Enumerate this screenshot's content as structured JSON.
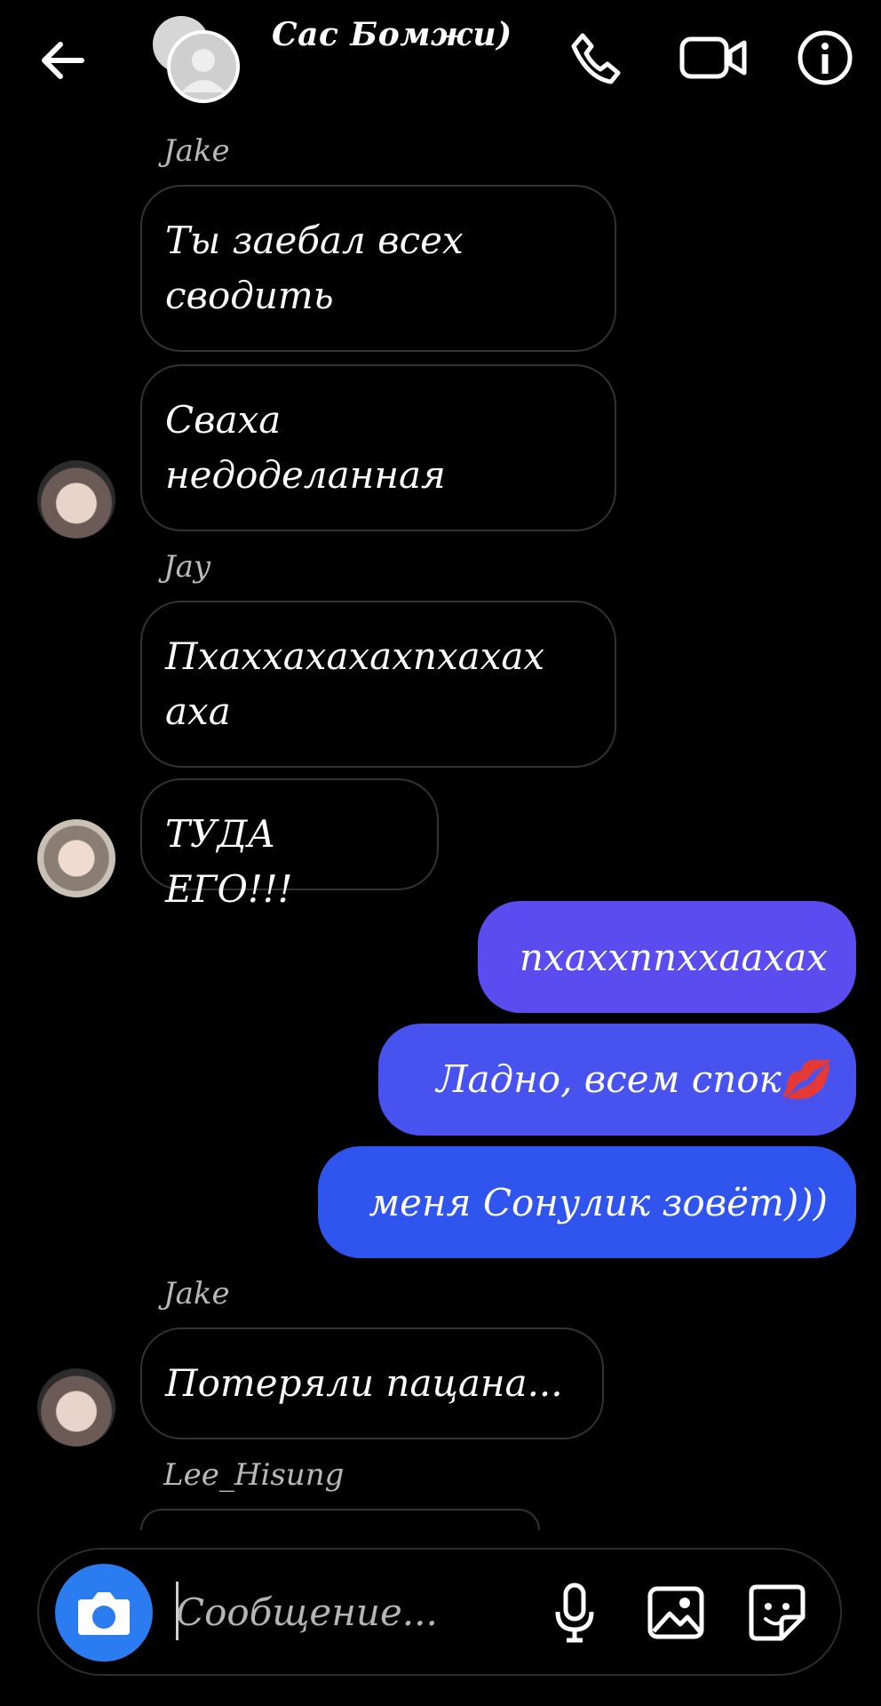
{
  "header": {
    "title": "Сас Бомжи)",
    "icons": [
      "back-arrow-icon",
      "group-avatar",
      "phone-icon",
      "video-camera-icon",
      "info-icon"
    ]
  },
  "messages": [
    {
      "sender": "Jake",
      "text_lines": [
        "Ты заебал всех",
        "сводить"
      ]
    },
    {
      "sender": "",
      "text_lines": [
        "Сваха",
        "недоделанная"
      ]
    },
    {
      "sender": "Jay",
      "text_lines": [
        "Пхаххахахахпхахах",
        "аха"
      ]
    },
    {
      "sender": "",
      "text_lines": [
        "ТУДА ЕГО!!!"
      ]
    },
    {
      "sender": "me",
      "text": "пхаххппххаахах"
    },
    {
      "sender": "me",
      "text": "Ладно, всем спок💋"
    },
    {
      "sender": "me",
      "text": "меня Сонулик зовёт)))"
    },
    {
      "sender": "Jake",
      "text_lines": [
        "Потеряли пацана..."
      ]
    },
    {
      "sender": "Lee_Hisung",
      "text_lines": [
        ""
      ]
    }
  ],
  "colors": {
    "background": "#000000",
    "outgoing_gradient_start": "#5b4cf0",
    "outgoing_gradient_end": "#2f55ee",
    "camera_button": "#2a7cf0"
  },
  "composer": {
    "placeholder": "Сообщение...",
    "icons": [
      "camera-icon",
      "microphone-icon",
      "image-icon",
      "sticker-icon"
    ]
  }
}
